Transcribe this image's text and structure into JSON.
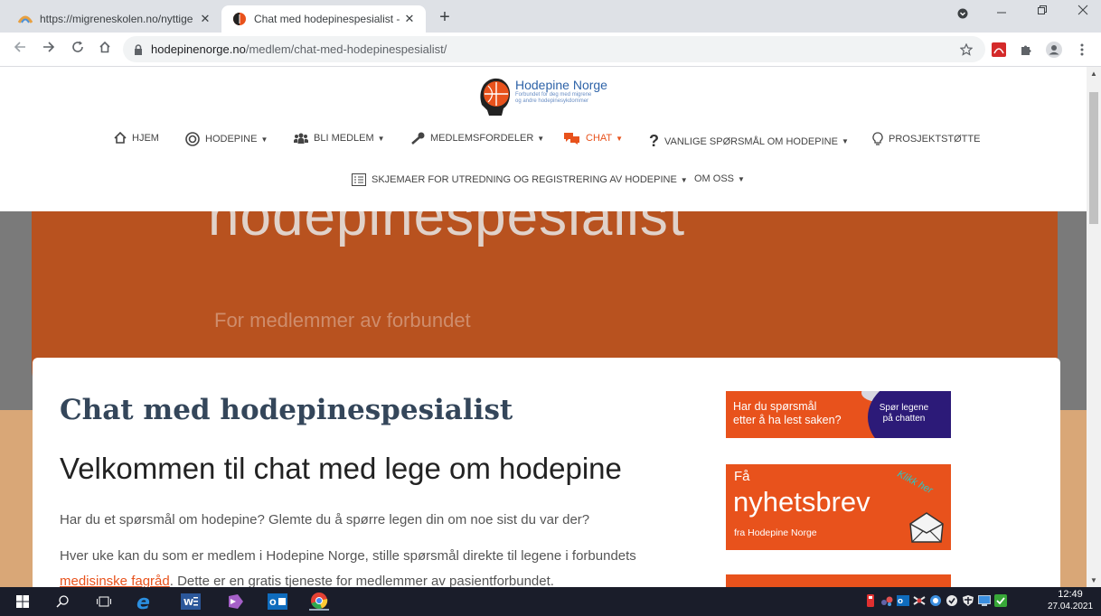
{
  "browser": {
    "tabs": [
      {
        "title": "https://migreneskolen.no/nyttige",
        "close": "✕"
      },
      {
        "title": "Chat med hodepinespesialist - H",
        "close": "✕"
      }
    ],
    "new_tab": "+",
    "url_domain": "hodepinenorge.no",
    "url_path": "/medlem/chat-med-hodepinespesialist/"
  },
  "site": {
    "logo_name": "Hodepine Norge",
    "logo_tagline_1": "Forbundet for deg med migrene",
    "logo_tagline_2": "og andre hodepinesykdommer",
    "menu": {
      "hjem": "HJEM",
      "hodepine": "HODEPINE",
      "bli_medlem": "BLI MEDLEM",
      "medlemsfordeler": "MEDLEMSFORDELER",
      "chat": "CHAT",
      "faq": "VANLIGE SPØRSMÅL OM HODEPINE",
      "prosjektstotte": "PROSJEKTSTØTTE",
      "skjemaer": "SKJEMAER FOR UTREDNING OG REGISTRERING AV HODEPINE",
      "om_oss": "OM OSS"
    },
    "hero_title": "hodepinespesialist",
    "hero_subtitle": "For medlemmer av forbundet"
  },
  "content": {
    "h1": "Chat med hodepinespesialist",
    "h2": "Velkommen til chat med lege om hodepine",
    "p1": "Har du et spørsmål om hodepine? Glemte du å spørre legen din om noe sist du var der?",
    "p2": "Hver uke kan du som er medlem i Hodepine Norge, stille spørsmål direkte til legene i forbundets",
    "p3_link": "medisinske fagråd",
    "p3_rest": ". Dette er en gratis tjeneste for medlemmer av pasientforbundet."
  },
  "sidebar": {
    "ad1_line1": "Har du spørsmål",
    "ad1_line2": "etter å ha lest saken?",
    "ad1_bubble_1": "Spør legene",
    "ad1_bubble_2": "på chatten",
    "ad2_fa": "Få",
    "ad2_big": "nyhetsbrev",
    "ad2_from": "fra Hodepine Norge",
    "ad2_klikk": "Klikk her"
  },
  "taskbar": {
    "time": "12:49",
    "date": "27.04.2021"
  },
  "colors": {
    "accent_orange": "#e8521c",
    "heading_blue": "#34465a",
    "logo_blue": "#2e63a8"
  }
}
